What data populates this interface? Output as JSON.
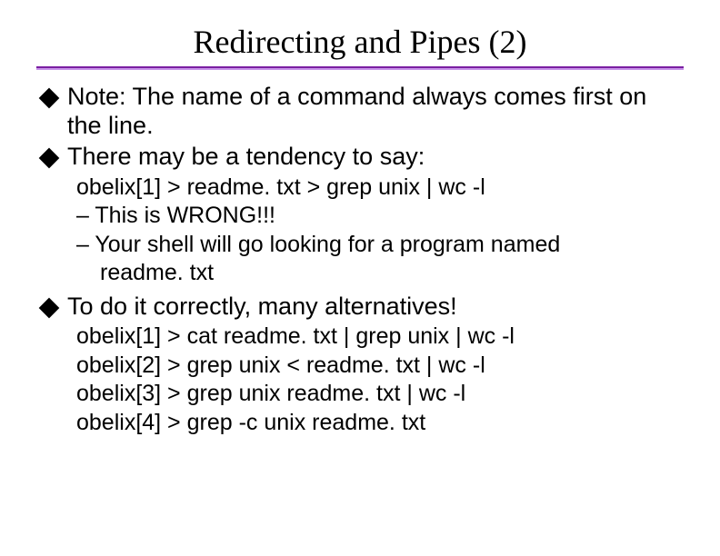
{
  "title": "Redirecting and Pipes (2)",
  "bullets": {
    "b1": "Note:  The name of a command always comes first on the line.",
    "b2": "There may be a tendency to say:",
    "b3": "To do it correctly, many alternatives!"
  },
  "sub1": {
    "l1": "obelix[1] > readme. txt > grep unix | wc -l",
    "l2": "– This is WRONG!!!",
    "l3": "– Your shell will go looking for a program named",
    "l3b": "readme. txt"
  },
  "sub2": {
    "l1": "obelix[1] > cat readme. txt | grep unix | wc -l",
    "l2": "obelix[2] > grep unix < readme. txt | wc -l",
    "l3": "obelix[3] > grep unix readme. txt | wc -l",
    "l4": "obelix[4] > grep -c unix readme. txt"
  }
}
